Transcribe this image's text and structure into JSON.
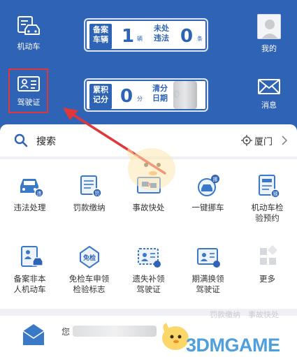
{
  "header": {
    "vehicle_label": "机动车",
    "license_label": "驾驶证",
    "me_label": "我的",
    "messages_label": "消息",
    "vehicles_card": {
      "label1": "备案车辆",
      "label1_line1": "备案",
      "label1_line2": "车辆",
      "count1": "1",
      "unit1": "辆",
      "label2_line1": "未处",
      "label2_line2": "违法",
      "count2": "0",
      "unit2": "条"
    },
    "license_card": {
      "label1_line1": "累积",
      "label1_line2": "记分",
      "count1": "0",
      "unit1": "分",
      "label2_line1": "清分",
      "label2_line2": "日期",
      "date_partial": "0"
    }
  },
  "search": {
    "label": "搜索",
    "city": "厦门"
  },
  "services": [
    {
      "line1": "违法处理",
      "line2": "",
      "icon": "violation-car-icon"
    },
    {
      "line1": "罚款缴纳",
      "line2": "",
      "icon": "fine-scroll-icon"
    },
    {
      "line1": "事故快处",
      "line2": "",
      "icon": "accident-photo-icon"
    },
    {
      "line1": "一键挪车",
      "line2": "",
      "icon": "move-car-icon"
    },
    {
      "line1": "机动车检",
      "line2": "验预约",
      "icon": "inspection-booking-icon"
    },
    {
      "line1": "备案非本",
      "line2": "人机动车",
      "icon": "registered-vehicle-icon"
    },
    {
      "line1": "免检车申领",
      "line2": "检验标志",
      "icon": "exempt-badge-icon"
    },
    {
      "line1": "遗失补领",
      "line2": "驾驶证",
      "icon": "lost-license-icon"
    },
    {
      "line1": "期满换领",
      "line2": "驾驶证",
      "icon": "renew-license-icon"
    },
    {
      "line1": "更多",
      "line2": "",
      "icon": "more-grid-icon"
    }
  ],
  "bottom": {
    "message_prefix": "您",
    "faint_left": "罚款缴纳",
    "faint_right": "事故快处"
  },
  "watermark": "3DMGAME",
  "colors": {
    "primary": "#2f63b5",
    "highlight": "#e0383a",
    "watermark": "#4f9fdc"
  }
}
